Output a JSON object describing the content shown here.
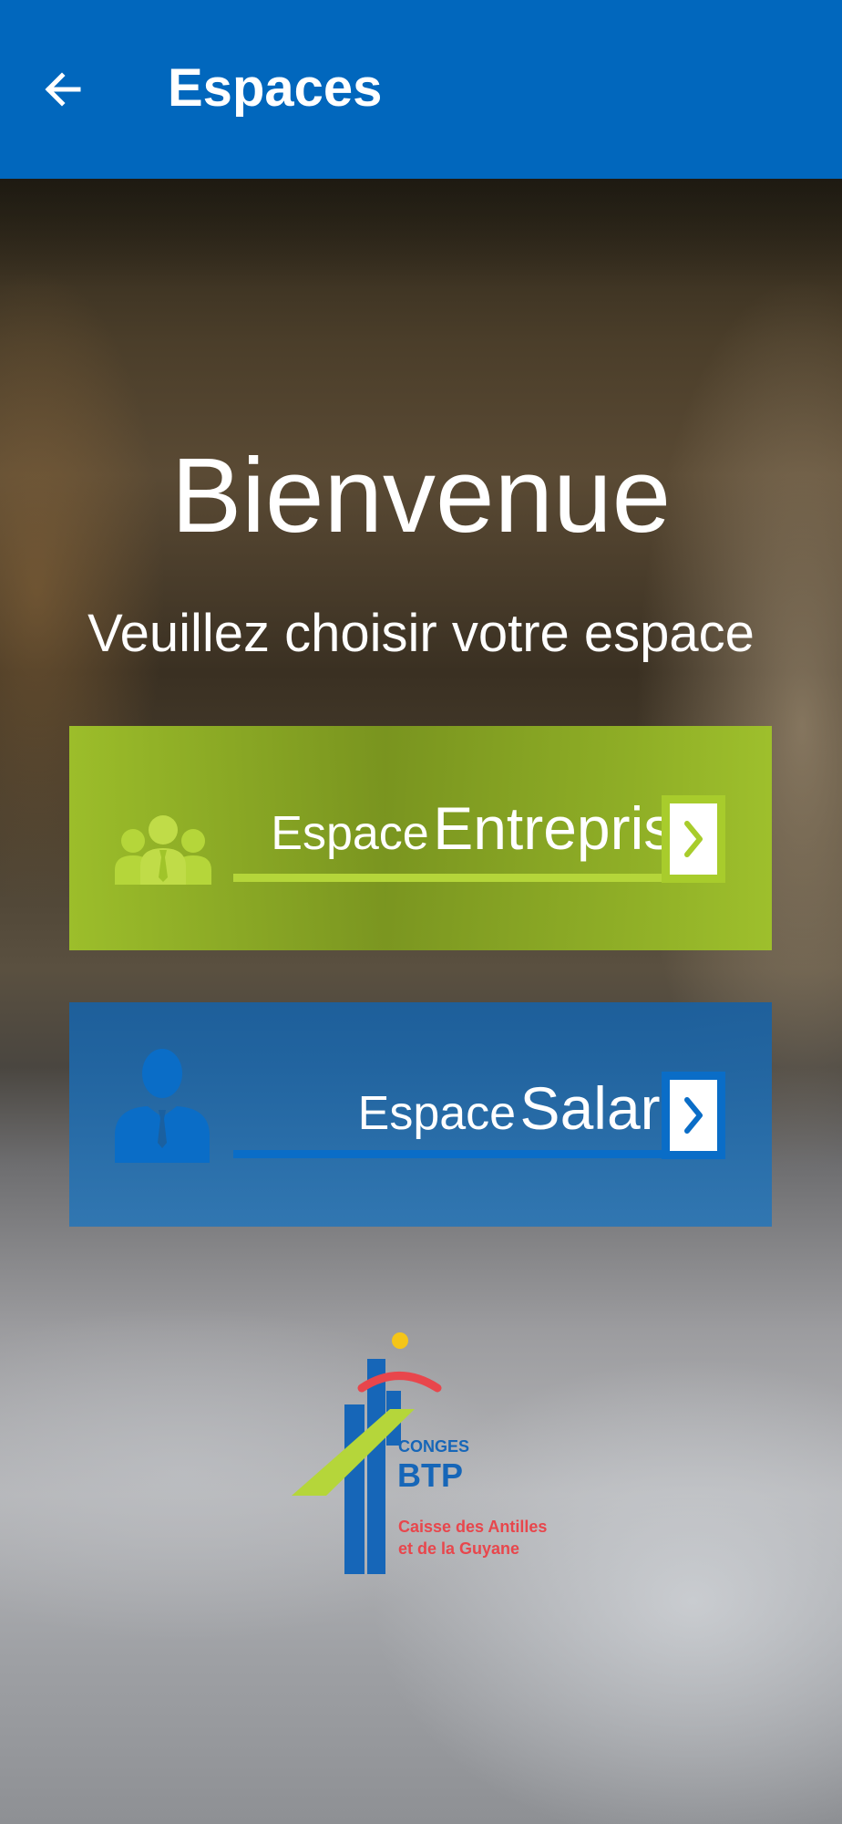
{
  "appbar": {
    "title": "Espaces",
    "back_icon": "arrow-left-icon",
    "background": "#0167bd"
  },
  "main": {
    "welcome": "Bienvenue",
    "subtitle": "Veuillez choisir votre espace"
  },
  "cards": [
    {
      "id": "entreprise",
      "label_prefix": "Espace",
      "label_main": "Entreprise",
      "icon": "group-users-icon",
      "action_icon": "chevron-right-icon",
      "color": "#a0c42a"
    },
    {
      "id": "salarie",
      "label_prefix": "Espace",
      "label_main": "Salarié",
      "icon": "user-icon",
      "action_icon": "chevron-right-icon",
      "color": "#1a60a0"
    }
  ],
  "logo": {
    "line1": "CONGES",
    "line2": "BTP",
    "line3": "Caisse des Antilles",
    "line4": "et de la Guyane"
  }
}
